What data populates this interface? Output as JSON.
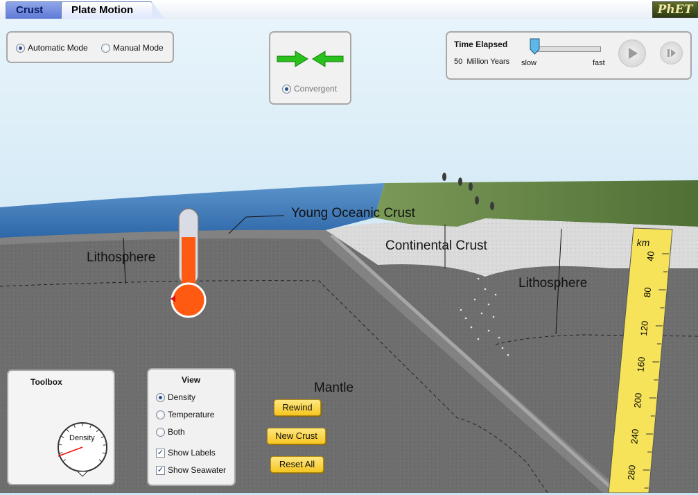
{
  "tabs": [
    {
      "label": "Crust",
      "active": false
    },
    {
      "label": "Plate Motion",
      "active": true
    }
  ],
  "logo_text": "PhET",
  "mode": {
    "automatic_label": "Automatic Mode",
    "manual_label": "Manual Mode",
    "selected": "automatic"
  },
  "motion": {
    "type_label": "Convergent",
    "arrow_color": "#29c21c"
  },
  "time": {
    "title": "Time Elapsed",
    "value": "50",
    "unit": "Million Years",
    "slow_label": "slow",
    "fast_label": "fast",
    "speed": 0.0
  },
  "scene_labels": {
    "young_oceanic_crust": "Young Oceanic Crust",
    "continental_crust": "Continental Crust",
    "lithosphere_left": "Lithosphere",
    "lithosphere_right": "Lithosphere",
    "mantle": "Mantle"
  },
  "thermometer": {
    "level": 0.62,
    "fluid_color": "#ff5a12"
  },
  "toolbox": {
    "title": "Toolbox",
    "gauge_label": "Density"
  },
  "view": {
    "title": "View",
    "options": [
      "Density",
      "Temperature",
      "Both"
    ],
    "selected": "Density",
    "show_labels_label": "Show Labels",
    "show_labels": true,
    "show_seawater_label": "Show Seawater",
    "show_seawater": true
  },
  "buttons": {
    "rewind": "Rewind",
    "new_crust": "New Crust",
    "reset_all": "Reset All"
  },
  "ruler": {
    "unit": "km",
    "ticks": [
      "40",
      "80",
      "120",
      "160",
      "200",
      "240",
      "280"
    ],
    "color": "#f6e35a"
  },
  "colors": {
    "sky": "#c9e4f3",
    "ocean": "#3a78b5",
    "mantle": "#6b6b6b",
    "continental": "#d9d9d9",
    "land": "#6b8a4c"
  }
}
